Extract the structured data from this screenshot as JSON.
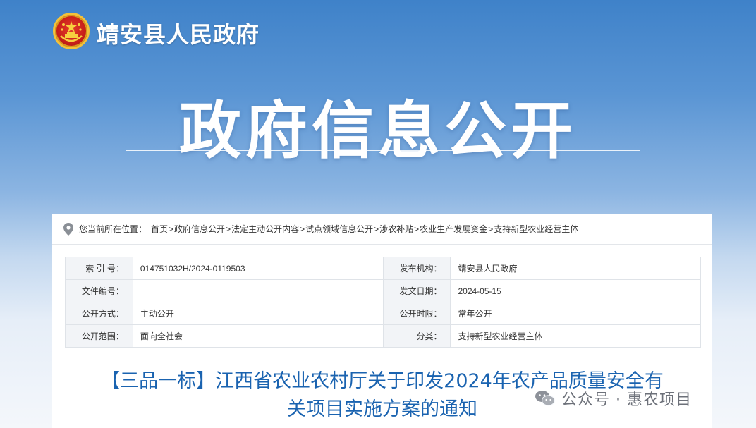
{
  "header": {
    "site_name": "靖安县人民政府",
    "banner_title": "政府信息公开"
  },
  "breadcrumb": {
    "prefix": "您当前所在位置：",
    "items": [
      "首页",
      "政府信息公开",
      "法定主动公开内容",
      "试点领域信息公开",
      "涉农补贴",
      "农业生产发展资金",
      "支持新型农业经营主体"
    ],
    "separator": ">"
  },
  "info": {
    "rows": [
      {
        "k1": "索 引 号：",
        "v1": "014751032H/2024-0119503",
        "k2": "发布机构：",
        "v2": "靖安县人民政府"
      },
      {
        "k1": "文件编号：",
        "v1": "",
        "k2": "发文日期：",
        "v2": "2024-05-15"
      },
      {
        "k1": "公开方式：",
        "v1": "主动公开",
        "k2": "公开时限：",
        "v2": "常年公开"
      },
      {
        "k1": "公开范围：",
        "v1": "面向全社会",
        "k2": "分类：",
        "v2": "支持新型农业经营主体"
      }
    ]
  },
  "document": {
    "title_line1": "【三品一标】江西省农业农村厅关于印发2024年农产品质量安全有",
    "title_line2": "关项目实施方案的通知"
  },
  "watermark": {
    "text": "公众号 · 惠农项目"
  },
  "colors": {
    "title_blue": "#1a63b0",
    "header_blue": "#3f82c9",
    "emblem_red": "#c8201a",
    "emblem_gold": "#f3c23a"
  }
}
